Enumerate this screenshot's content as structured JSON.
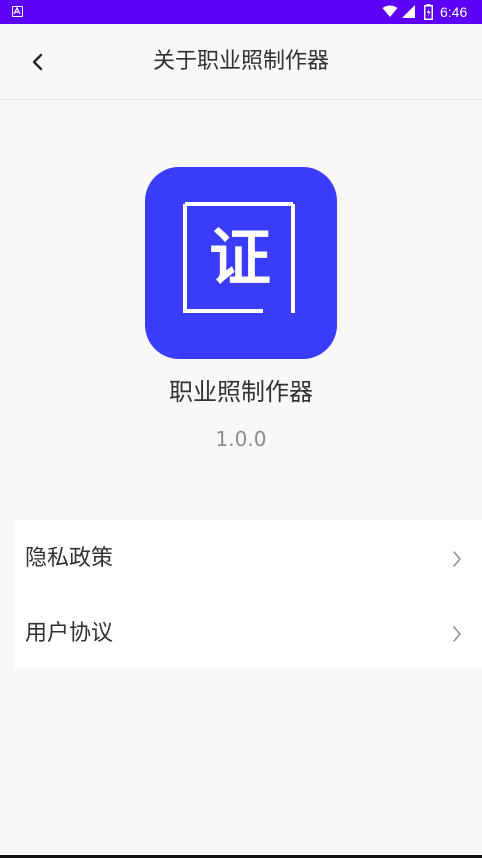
{
  "status_bar": {
    "time": "6:46",
    "icons": [
      "app-notification-icon",
      "wifi-icon",
      "signal-icon",
      "battery-icon"
    ],
    "background": "#5b00f5"
  },
  "header": {
    "back_icon": "chevron-left-icon",
    "title": "关于职业照制作器"
  },
  "app": {
    "logo_char": "证",
    "logo_color": "#3a3cfa",
    "name": "职业照制作器",
    "version": "1.0.0"
  },
  "menu": {
    "items": [
      {
        "label": "隐私政策",
        "icon": "chevron-right-icon"
      },
      {
        "label": "用户协议",
        "icon": "chevron-right-icon"
      }
    ]
  }
}
